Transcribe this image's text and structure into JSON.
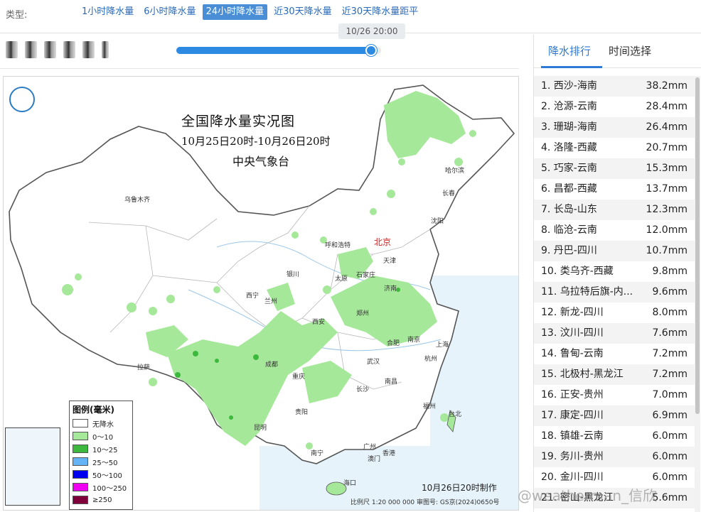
{
  "type_bar": {
    "label": "类型:",
    "tabs": [
      {
        "label": "1小时降水量",
        "active": false
      },
      {
        "label": "6小时降水量",
        "active": false
      },
      {
        "label": "24小时降水量",
        "active": true
      },
      {
        "label": "近30天降水量",
        "active": false
      },
      {
        "label": "近30天降水量距平",
        "active": false
      }
    ]
  },
  "timeline": {
    "current_time": "10/26 20:00",
    "progress": 0.95
  },
  "map": {
    "title": "全国降水量实况图",
    "subtitle": "10月25日20时-10月26日20时",
    "agency": "中央气象台",
    "made_note": "10月26日20时制作",
    "scale_note": "比例尺 1:20 000 000   审图号: GS京(2024)0650号",
    "cities": [
      "乌鲁木齐",
      "哈尔滨",
      "长春",
      "沈阳",
      "北京",
      "天津",
      "呼和浩特",
      "石家庄",
      "太原",
      "银川",
      "济南",
      "西宁",
      "兰州",
      "郑州",
      "西安",
      "合肥",
      "南京",
      "上海",
      "拉萨",
      "成都",
      "武汉",
      "杭州",
      "重庆",
      "长沙",
      "南昌",
      "贵阳",
      "福州",
      "台北",
      "昆明",
      "广州",
      "南宁",
      "澳门",
      "香港",
      "海口"
    ],
    "legend": {
      "title": "图例(毫米)",
      "items": [
        {
          "label": "无降水",
          "color": "#ffffff"
        },
        {
          "label": "0～10",
          "color": "#a6e89a"
        },
        {
          "label": "10～25",
          "color": "#3cb83c"
        },
        {
          "label": "25～50",
          "color": "#64b4f5"
        },
        {
          "label": "50～100",
          "color": "#0000f0"
        },
        {
          "label": "100～250",
          "color": "#f000f0"
        },
        {
          "label": "≥250",
          "color": "#80003c"
        }
      ]
    }
  },
  "panel": {
    "tabs": [
      "降水排行",
      "时间选择"
    ],
    "ranking": [
      {
        "name": "1. 西沙-海南",
        "value": "38.2mm"
      },
      {
        "name": "2. 沧源-云南",
        "value": "28.4mm"
      },
      {
        "name": "3. 珊瑚-海南",
        "value": "26.4mm"
      },
      {
        "name": "4. 洛隆-西藏",
        "value": "20.7mm"
      },
      {
        "name": "5. 巧家-云南",
        "value": "15.3mm"
      },
      {
        "name": "6. 昌都-西藏",
        "value": "13.7mm"
      },
      {
        "name": "7. 长岛-山东",
        "value": "12.3mm"
      },
      {
        "name": "8. 临沧-云南",
        "value": "12.0mm"
      },
      {
        "name": "9. 丹巴-四川",
        "value": "10.7mm"
      },
      {
        "name": "10. 类乌齐-西藏",
        "value": "9.8mm"
      },
      {
        "name": "11. 乌拉特后旗-内...",
        "value": "9.6mm"
      },
      {
        "name": "12. 新龙-四川",
        "value": "8.0mm"
      },
      {
        "name": "13. 汶川-四川",
        "value": "7.6mm"
      },
      {
        "name": "14. 鲁甸-云南",
        "value": "7.2mm"
      },
      {
        "name": "15. 北极村-黑龙江",
        "value": "7.2mm"
      },
      {
        "name": "16. 正安-贵州",
        "value": "7.0mm"
      },
      {
        "name": "17. 康定-四川",
        "value": "6.9mm"
      },
      {
        "name": "18. 镇雄-云南",
        "value": "6.0mm"
      },
      {
        "name": "19. 务川-贵州",
        "value": "6.0mm"
      },
      {
        "name": "20. 金川-四川",
        "value": "6.0mm"
      },
      {
        "name": "21. 密山-黑龙江",
        "value": "5.6mm"
      }
    ]
  },
  "watermark": "@weatherman_信欣",
  "colors": {
    "accent": "#2d7ad6",
    "light_rain": "#a6e89a",
    "moderate_rain": "#3cb83c"
  }
}
